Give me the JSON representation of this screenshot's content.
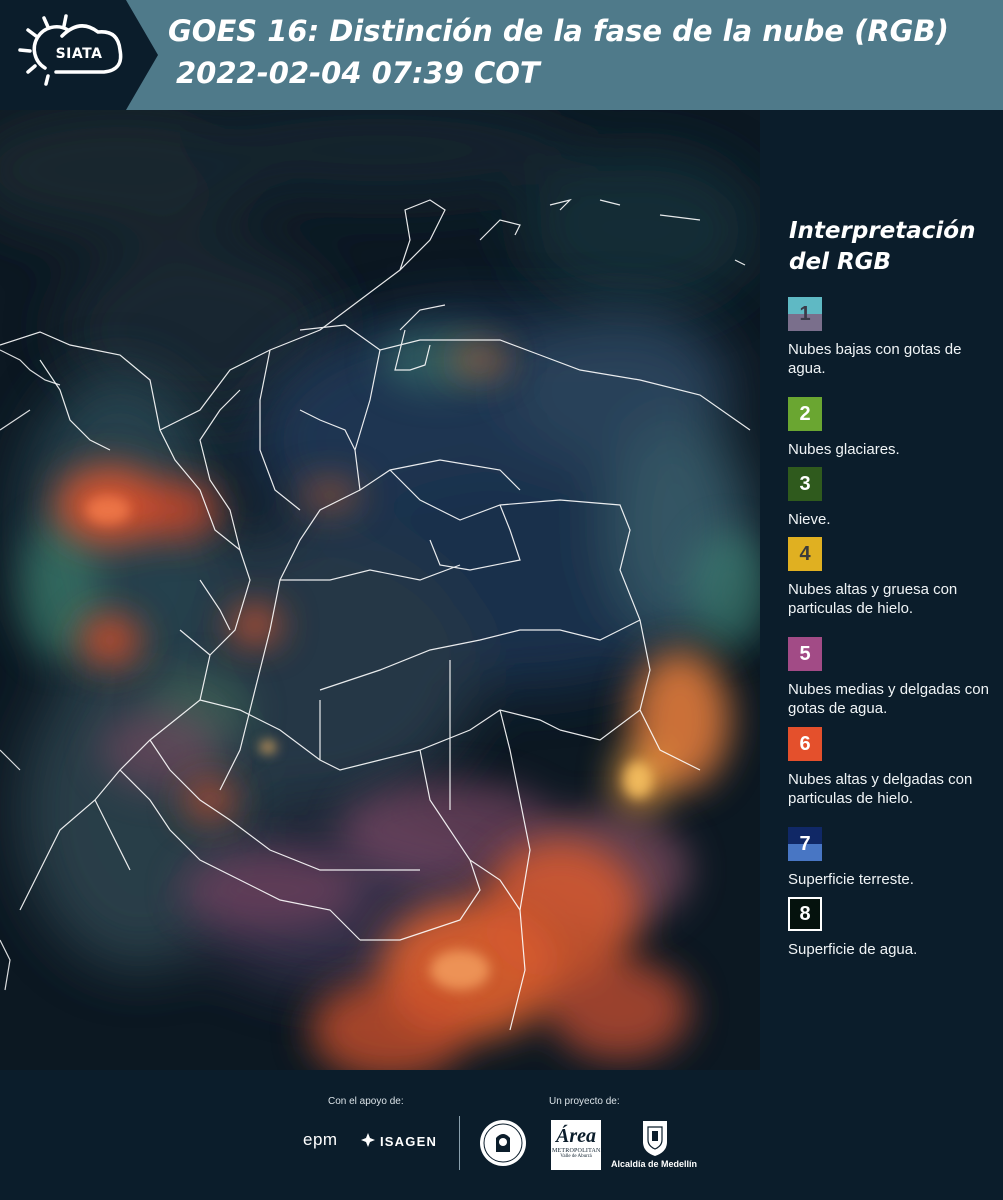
{
  "header": {
    "logo_text": "SIATA",
    "title_line1": "GOES 16: Distinción de la fase de la nube (RGB)",
    "title_line2": "2022-02-04 07:39 COT"
  },
  "colors": {
    "header_bg": "#4f7a8a",
    "panel_bg": "#0b1d2b",
    "border_lines": "#ffffff"
  },
  "legend": {
    "title": "Interpretación del RGB",
    "items": [
      {
        "number": "1",
        "label": "Nubes bajas con gotas de agua.",
        "color_top": "#5fb9c4",
        "color_bottom": "#7a6f8c",
        "number_color": "#3a3a48"
      },
      {
        "number": "2",
        "label": "Nubes glaciares.",
        "color_top": "#6aa631",
        "color_bottom": "#6aa631",
        "number_color": "#ffffff"
      },
      {
        "number": "3",
        "label": "Nieve.",
        "color_top": "#2f5a1d",
        "color_bottom": "#2f5a1d",
        "number_color": "#ffffff"
      },
      {
        "number": "4",
        "label": "Nubes altas y gruesa con particulas de hielo.",
        "color_top": "#e0b021",
        "color_bottom": "#e0b021",
        "number_color": "#3a3a3a"
      },
      {
        "number": "5",
        "label": "Nubes medias y delgadas con gotas de agua.",
        "color_top": "#a24b86",
        "color_bottom": "#a24b86",
        "number_color": "#ffffff"
      },
      {
        "number": "6",
        "label": "Nubes altas y delgadas con particulas de hielo.",
        "color_top": "#e4502c",
        "color_bottom": "#e4502c",
        "number_color": "#ffffff"
      },
      {
        "number": "7",
        "label": "Superficie terreste.",
        "color_top": "#102866",
        "color_bottom": "#4876c4",
        "number_color": "#ffffff"
      },
      {
        "number": "8",
        "label": "Superficie de agua.",
        "color_top": "#05120d",
        "color_bottom": "#05120d",
        "number_color": "#ffffff",
        "border": "#ffffff"
      }
    ]
  },
  "footer": {
    "support_label": "Con el apoyo de:",
    "project_label": "Un proyecto de:",
    "epm": "epm",
    "isagen": "ISAGEN",
    "area_logo": {
      "a": "Área",
      "metro": "METROPOLITANA",
      "valle": "Valle de Aburrá"
    },
    "alcaldia": "Alcaldía de Medellín"
  }
}
